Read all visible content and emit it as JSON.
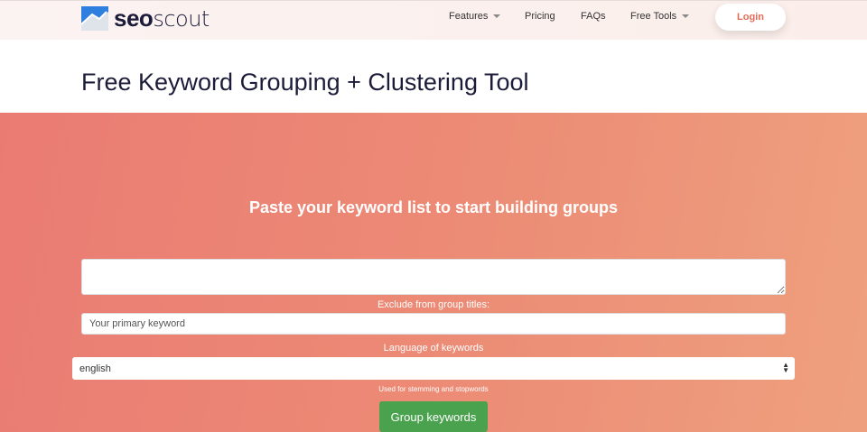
{
  "nav": {
    "logo_bold": "seo",
    "logo_light": "scout",
    "items": [
      {
        "label": "Features",
        "dropdown": true
      },
      {
        "label": "Pricing"
      },
      {
        "label": "FAQs"
      },
      {
        "label": "Free Tools",
        "dropdown": true
      }
    ],
    "login": "Login"
  },
  "page": {
    "title": "Free Keyword Grouping + Clustering Tool"
  },
  "form": {
    "heading": "Paste your keyword list to start building groups",
    "keywords_value": "",
    "exclude_label": "Exclude from group titles:",
    "exclude_placeholder": "Your primary keyword",
    "language_label": "Language of keywords",
    "language_value": "english",
    "language_help": "Used for stemming and stopwords",
    "submit": "Group keywords"
  },
  "colors": {
    "accent": "#e86a57",
    "button": "#4aa24e"
  }
}
